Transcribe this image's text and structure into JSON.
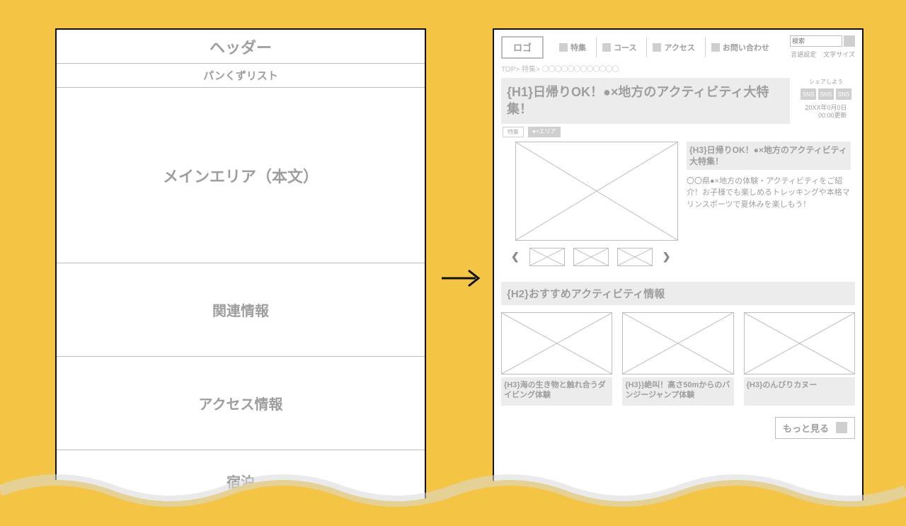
{
  "left": {
    "header": "ヘッダー",
    "crumbs": "パンくずリスト",
    "main": "メインエリア（本文）",
    "related": "関連情報",
    "access": "アクセス情報",
    "stay": "宿泊"
  },
  "right": {
    "logo": "ロゴ",
    "nav": [
      "特集",
      "コース",
      "アクセス",
      "お問い合わせ"
    ],
    "search_placeholder": "検索",
    "lang": "言語設定",
    "textsize": "文字サイズ",
    "breadcrumb_prefix": "TOP> 特集> ",
    "breadcrumb_placeholder": "〇〇〇〇〇〇〇〇〇〇〇〇",
    "h1": "{H1}日帰りOK！●×地方のアクティビティ大特集！",
    "share_label": "シェアしよう",
    "sns": "SNS",
    "date_line1": "20XX年0月0日",
    "date_line2": "00:00更新",
    "tag1": "特集",
    "tag2": "●×エリア",
    "h3_hero": "{H3}日帰りOK！●×地方のアクティビティ大特集！",
    "hero_body": "〇〇県●×地方の体験・アクティビティをご紹介！お子様でも楽しめるトレッキングや本格マリンスポーツで夏休みを楽しもう！",
    "h2": "{H2}おすすめアクティビティ情報",
    "cards": [
      "{H3}海の生き物と触れ合うダイビング体験",
      "{H3}}絶叫！高さ50mからのバンジージャンプ体験",
      "{H3}のんびりカヌー"
    ],
    "more": "もっと見る"
  }
}
